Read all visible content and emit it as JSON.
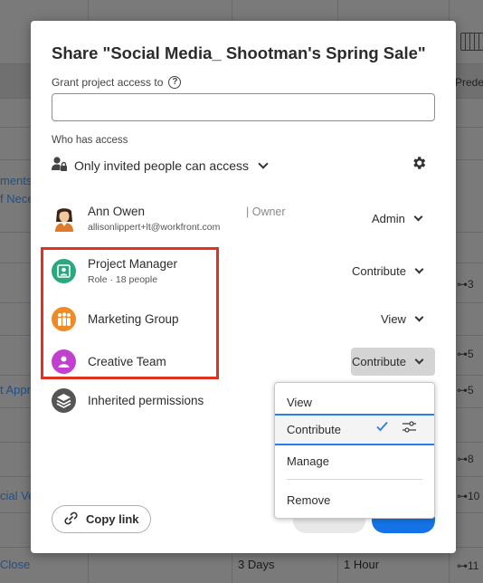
{
  "background": {
    "texts": [
      {
        "text": "ments,",
        "link": true
      },
      {
        "text": "f Nece",
        "link": true
      },
      {
        "text": "t Appr",
        "link": true
      },
      {
        "text": "cial Ve",
        "link": true
      },
      {
        "text": "Close",
        "link": true
      },
      {
        "text": "3 Days",
        "link": false
      },
      {
        "text": "1 Hour",
        "link": false
      }
    ],
    "pred_header": "Prede",
    "pred_values": [
      "3",
      "5",
      "5",
      "8",
      "10",
      "11"
    ]
  },
  "modal": {
    "title": "Share \"Social Media_ Shootman's Spring Sale\"",
    "grant_label": "Grant project access to",
    "grant_input_value": "",
    "grant_input_placeholder": "",
    "who_label": "Who has access",
    "access_setting": "Only invited people can access",
    "entries": [
      {
        "name": "Ann Owen",
        "sub": "allisonlippert+lt@workfront.com",
        "tag": "| Owner",
        "role": "Admin",
        "icon": "user-avatar-icon"
      },
      {
        "name": "Project Manager",
        "sub": "Role · 18 people",
        "role": "Contribute",
        "icon": "role-icon",
        "color": "#2aa87f"
      },
      {
        "name": "Marketing Group",
        "sub": "",
        "role": "View",
        "icon": "group-icon",
        "color": "#ef8a26"
      },
      {
        "name": "Creative Team",
        "sub": "",
        "role": "Contribute",
        "icon": "team-icon",
        "color": "#c23fcf"
      }
    ],
    "inherited_label": "Inherited permissions",
    "copy_link_label": "Copy link",
    "highlight_color": "#e0321e"
  },
  "menu": {
    "items": [
      "View",
      "Contribute",
      "Manage",
      "Remove"
    ],
    "selected": "Contribute",
    "accent": "#2680eb"
  }
}
